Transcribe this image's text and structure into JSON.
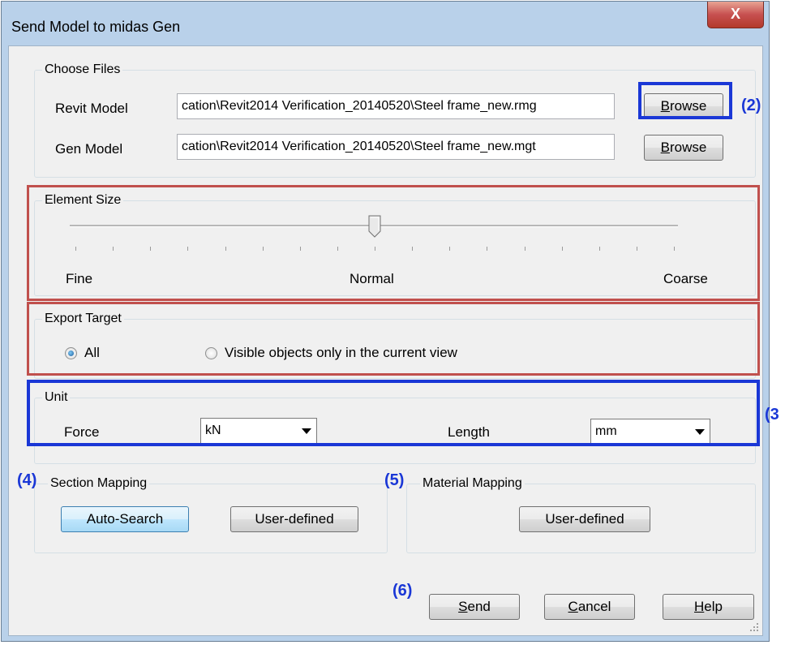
{
  "window": {
    "title": "Send Model to midas Gen",
    "close_label": "X"
  },
  "choose_files": {
    "label": "Choose Files",
    "revit_label": "Revit Model",
    "revit_path": "cation\\Revit2014 Verification_20140520\\Steel frame_new.rmg",
    "gen_label": "Gen Model",
    "gen_path": "cation\\Revit2014 Verification_20140520\\Steel frame_new.mgt",
    "browse_pre": "B",
    "browse_rest": "rowse"
  },
  "element_size": {
    "label": "Element Size",
    "fine": "Fine",
    "normal": "Normal",
    "coarse": "Coarse",
    "slider_value": 0.5,
    "tick_count": 17
  },
  "export_target": {
    "label": "Export Target",
    "option_all": "All",
    "option_visible": "Visible objects only in the current view",
    "selected": "All"
  },
  "unit": {
    "label": "Unit",
    "force_label": "Force",
    "force_value": "kN",
    "length_label": "Length",
    "length_value": "mm"
  },
  "section_mapping": {
    "label": "Section Mapping",
    "auto_search": "Auto-Search",
    "user_defined": "User-defined"
  },
  "material_mapping": {
    "label": "Material Mapping",
    "user_defined": "User-defined"
  },
  "footer": {
    "send_pre": "S",
    "send_rest": "end",
    "cancel_pre": "C",
    "cancel_rest": "ancel",
    "help_pre": "H",
    "help_rest": "elp"
  },
  "annotations": {
    "a2": "(2)",
    "a3": "(3",
    "a4": "(4)",
    "a5": "(5)",
    "a6": "(6)"
  },
  "colors": {
    "highlight_blue": "#1a37d6",
    "highlight_red": "#c0504d",
    "title_bar": "#b9d1ea"
  }
}
